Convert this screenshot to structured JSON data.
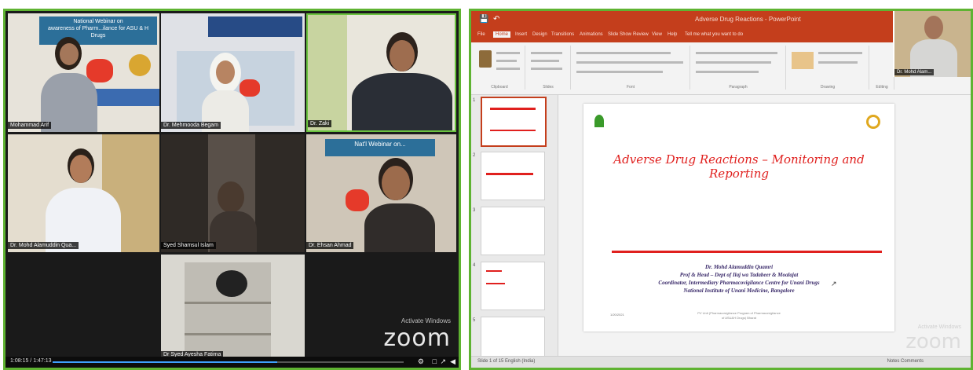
{
  "zoom": {
    "participants": [
      {
        "name": "Mohammad Arif"
      },
      {
        "name": "Dr. Mehmooda Begam"
      },
      {
        "name": "Dr. Zaki"
      },
      {
        "name": "Dr. Mohd Alamuddin Qua..."
      },
      {
        "name": "Syed Shamsul Islam"
      },
      {
        "name": "Dr. Ehsan Ahmad"
      },
      {
        "name": "Dr Syed Ayesha Fatima"
      }
    ],
    "banner_1": "National Webinar on\nawareness of Pharm...ilance for ASU & H Drugs",
    "banner_2": "Nat'l Webinar on...",
    "banner_3": "Ph.D Reg",
    "watermark_activate": "Activate Windows",
    "watermark_zoom": "zoom",
    "time": "1:08:15 / 1:47:13",
    "progress": 0.64,
    "accent": "#5fb332"
  },
  "powerpoint": {
    "window_title": "Adverse Drug Reactions - PowerPoint",
    "tabs": [
      "File",
      "Home",
      "Insert",
      "Design",
      "Transitions",
      "Animations",
      "Slide Show",
      "Review",
      "View",
      "Help",
      "Tell me what you want to do"
    ],
    "active_tab": "Home",
    "ribbon_groups": [
      "Clipboard",
      "Slides",
      "Font",
      "Paragraph",
      "Drawing",
      "Editing"
    ],
    "slide_numbers": [
      "1",
      "2",
      "3",
      "4",
      "5"
    ],
    "slide": {
      "title": "Adverse Drug Reactions – Monitoring and Reporting",
      "credits": [
        "Dr. Mohd Alamuddin Quamri",
        "Prof & Head – Dept of Ilaj wa Tadabeer & Moalajat",
        "Coordinator, Intermediary Pharmacovigilance Centre for Unani Drugs",
        "National Institute of Unani Medicine, Bangalore"
      ],
      "footer_left": "1/20/2021",
      "footer_center": "PV Unit (Pharmacovigilance Program of Pharmacovigilance\nof ASU&H Drugs) Bharat"
    },
    "status_left": "Slide 1 of 15   English (India)",
    "status_right": "Notes   Comments",
    "camera_name": "Dr. Mohd Alam...",
    "watermark_activate": "Activate Windows",
    "watermark_zoom": "zoom",
    "brand_color": "#c43e1c"
  }
}
